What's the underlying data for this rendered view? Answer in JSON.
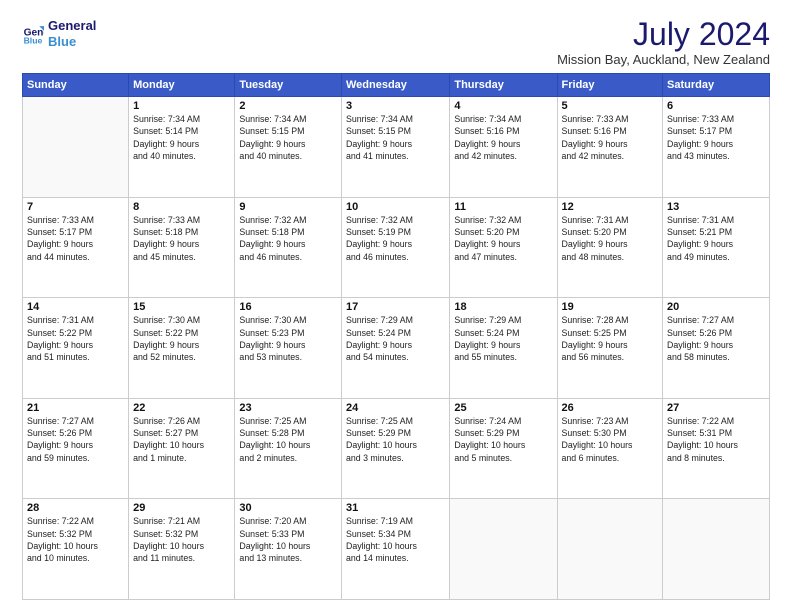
{
  "header": {
    "logo_line1": "General",
    "logo_line2": "Blue",
    "month_title": "July 2024",
    "location": "Mission Bay, Auckland, New Zealand"
  },
  "days_of_week": [
    "Sunday",
    "Monday",
    "Tuesday",
    "Wednesday",
    "Thursday",
    "Friday",
    "Saturday"
  ],
  "weeks": [
    [
      {
        "day": "",
        "info": ""
      },
      {
        "day": "1",
        "info": "Sunrise: 7:34 AM\nSunset: 5:14 PM\nDaylight: 9 hours\nand 40 minutes."
      },
      {
        "day": "2",
        "info": "Sunrise: 7:34 AM\nSunset: 5:15 PM\nDaylight: 9 hours\nand 40 minutes."
      },
      {
        "day": "3",
        "info": "Sunrise: 7:34 AM\nSunset: 5:15 PM\nDaylight: 9 hours\nand 41 minutes."
      },
      {
        "day": "4",
        "info": "Sunrise: 7:34 AM\nSunset: 5:16 PM\nDaylight: 9 hours\nand 42 minutes."
      },
      {
        "day": "5",
        "info": "Sunrise: 7:33 AM\nSunset: 5:16 PM\nDaylight: 9 hours\nand 42 minutes."
      },
      {
        "day": "6",
        "info": "Sunrise: 7:33 AM\nSunset: 5:17 PM\nDaylight: 9 hours\nand 43 minutes."
      }
    ],
    [
      {
        "day": "7",
        "info": "Sunrise: 7:33 AM\nSunset: 5:17 PM\nDaylight: 9 hours\nand 44 minutes."
      },
      {
        "day": "8",
        "info": "Sunrise: 7:33 AM\nSunset: 5:18 PM\nDaylight: 9 hours\nand 45 minutes."
      },
      {
        "day": "9",
        "info": "Sunrise: 7:32 AM\nSunset: 5:18 PM\nDaylight: 9 hours\nand 46 minutes."
      },
      {
        "day": "10",
        "info": "Sunrise: 7:32 AM\nSunset: 5:19 PM\nDaylight: 9 hours\nand 46 minutes."
      },
      {
        "day": "11",
        "info": "Sunrise: 7:32 AM\nSunset: 5:20 PM\nDaylight: 9 hours\nand 47 minutes."
      },
      {
        "day": "12",
        "info": "Sunrise: 7:31 AM\nSunset: 5:20 PM\nDaylight: 9 hours\nand 48 minutes."
      },
      {
        "day": "13",
        "info": "Sunrise: 7:31 AM\nSunset: 5:21 PM\nDaylight: 9 hours\nand 49 minutes."
      }
    ],
    [
      {
        "day": "14",
        "info": "Sunrise: 7:31 AM\nSunset: 5:22 PM\nDaylight: 9 hours\nand 51 minutes."
      },
      {
        "day": "15",
        "info": "Sunrise: 7:30 AM\nSunset: 5:22 PM\nDaylight: 9 hours\nand 52 minutes."
      },
      {
        "day": "16",
        "info": "Sunrise: 7:30 AM\nSunset: 5:23 PM\nDaylight: 9 hours\nand 53 minutes."
      },
      {
        "day": "17",
        "info": "Sunrise: 7:29 AM\nSunset: 5:24 PM\nDaylight: 9 hours\nand 54 minutes."
      },
      {
        "day": "18",
        "info": "Sunrise: 7:29 AM\nSunset: 5:24 PM\nDaylight: 9 hours\nand 55 minutes."
      },
      {
        "day": "19",
        "info": "Sunrise: 7:28 AM\nSunset: 5:25 PM\nDaylight: 9 hours\nand 56 minutes."
      },
      {
        "day": "20",
        "info": "Sunrise: 7:27 AM\nSunset: 5:26 PM\nDaylight: 9 hours\nand 58 minutes."
      }
    ],
    [
      {
        "day": "21",
        "info": "Sunrise: 7:27 AM\nSunset: 5:26 PM\nDaylight: 9 hours\nand 59 minutes."
      },
      {
        "day": "22",
        "info": "Sunrise: 7:26 AM\nSunset: 5:27 PM\nDaylight: 10 hours\nand 1 minute."
      },
      {
        "day": "23",
        "info": "Sunrise: 7:25 AM\nSunset: 5:28 PM\nDaylight: 10 hours\nand 2 minutes."
      },
      {
        "day": "24",
        "info": "Sunrise: 7:25 AM\nSunset: 5:29 PM\nDaylight: 10 hours\nand 3 minutes."
      },
      {
        "day": "25",
        "info": "Sunrise: 7:24 AM\nSunset: 5:29 PM\nDaylight: 10 hours\nand 5 minutes."
      },
      {
        "day": "26",
        "info": "Sunrise: 7:23 AM\nSunset: 5:30 PM\nDaylight: 10 hours\nand 6 minutes."
      },
      {
        "day": "27",
        "info": "Sunrise: 7:22 AM\nSunset: 5:31 PM\nDaylight: 10 hours\nand 8 minutes."
      }
    ],
    [
      {
        "day": "28",
        "info": "Sunrise: 7:22 AM\nSunset: 5:32 PM\nDaylight: 10 hours\nand 10 minutes."
      },
      {
        "day": "29",
        "info": "Sunrise: 7:21 AM\nSunset: 5:32 PM\nDaylight: 10 hours\nand 11 minutes."
      },
      {
        "day": "30",
        "info": "Sunrise: 7:20 AM\nSunset: 5:33 PM\nDaylight: 10 hours\nand 13 minutes."
      },
      {
        "day": "31",
        "info": "Sunrise: 7:19 AM\nSunset: 5:34 PM\nDaylight: 10 hours\nand 14 minutes."
      },
      {
        "day": "",
        "info": ""
      },
      {
        "day": "",
        "info": ""
      },
      {
        "day": "",
        "info": ""
      }
    ]
  ]
}
